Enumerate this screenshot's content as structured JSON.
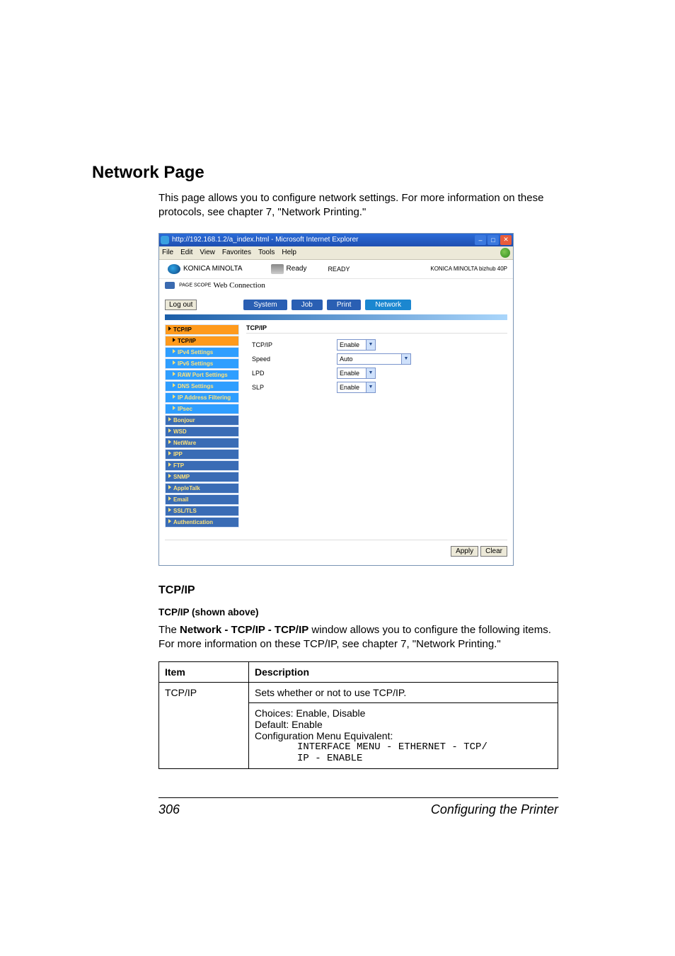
{
  "heading": "Network Page",
  "intro": "This page allows you to configure network settings. For more information on these protocols, see chapter 7, \"Network Printing.\"",
  "screenshot": {
    "titlebar": "http://192.168.1.2/a_index.html - Microsoft Internet Explorer",
    "winbtns": {
      "min": "–",
      "max": "□",
      "close": "✕"
    },
    "menus": {
      "file": "File",
      "edit": "Edit",
      "view": "View",
      "favorites": "Favorites",
      "tools": "Tools",
      "help": "Help"
    },
    "header": {
      "brand": "KONICA MINOLTA",
      "status_icon_label": "Ready",
      "status_big": "READY",
      "model": "KONICA MINOLTA bizhub 40P",
      "pagescope": "Web Connection",
      "pagescope_prefix": "PAGE SCOPE"
    },
    "logout": "Log out",
    "tabs": {
      "system": "System",
      "job": "Job",
      "print": "Print",
      "network": "Network"
    },
    "sidebar": {
      "tcpip": "TCP/IP",
      "sub_tcpip": "TCP/IP",
      "ipv4": "IPv4 Settings",
      "ipv6": "IPv6 Settings",
      "rawport": "RAW Port Settings",
      "dns": "DNS Settings",
      "ipfilter": "IP Address Filtering",
      "ipsec": "IPsec",
      "bonjour": "Bonjour",
      "wsd": "WSD",
      "netware": "NetWare",
      "ipp": "IPP",
      "ftp": "FTP",
      "snmp": "SNMP",
      "appletalk": "AppleTalk",
      "email": "Email",
      "ssl": "SSL/TLS",
      "auth": "Authentication"
    },
    "main": {
      "pane_title": "TCP/IP",
      "rows": {
        "tcpip": {
          "label": "TCP/IP",
          "value": "Enable"
        },
        "speed": {
          "label": "Speed",
          "value": "Auto"
        },
        "lpd": {
          "label": "LPD",
          "value": "Enable"
        },
        "slp": {
          "label": "SLP",
          "value": "Enable"
        }
      }
    },
    "buttons": {
      "apply": "Apply",
      "clear": "Clear"
    }
  },
  "sub_heading": "TCP/IP",
  "sub_label": "TCP/IP (shown above)",
  "body1_pre": "The ",
  "body1_bold": "Network - TCP/IP - TCP/IP",
  "body1_post": " window allows you to configure the following items. For more information on these TCP/IP, see chapter 7, \"Network Printing.\"",
  "table": {
    "headers": {
      "item": "Item",
      "desc": "Description"
    },
    "row": {
      "item": "TCP/IP",
      "line1": "Sets whether or not to use TCP/IP.",
      "choices": "Choices: Enable, Disable",
      "default": "Default:  Enable",
      "cfgmenu": "Configuration Menu Equivalent:",
      "path1": "INTERFACE MENU - ETHERNET - TCP/",
      "path2": "IP - ENABLE"
    }
  },
  "footer": {
    "page": "306",
    "label": "Configuring the Printer"
  }
}
